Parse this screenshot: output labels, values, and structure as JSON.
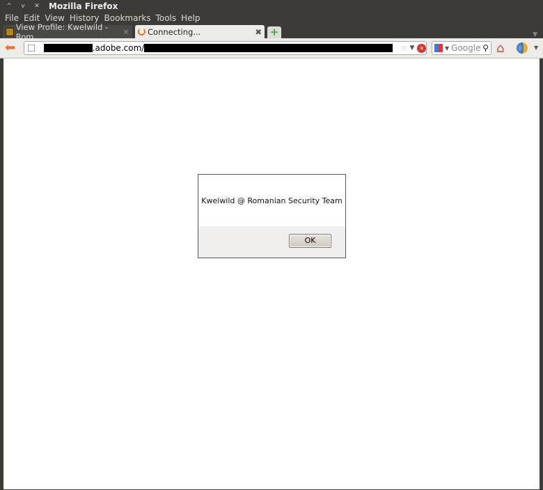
{
  "window": {
    "title": "Mozilla Firefox"
  },
  "menu": [
    "File",
    "Edit",
    "View",
    "History",
    "Bookmarks",
    "Tools",
    "Help"
  ],
  "tabs": [
    {
      "label": "View Profile: Kwelwild - Rom..."
    },
    {
      "label": "Connecting..."
    }
  ],
  "navbar": {
    "url_visible": ".adobe.com/",
    "search_placeholder": "Google"
  },
  "dialog": {
    "message": "Kwelwild @ Romanian Security Team",
    "ok_label": "OK"
  }
}
